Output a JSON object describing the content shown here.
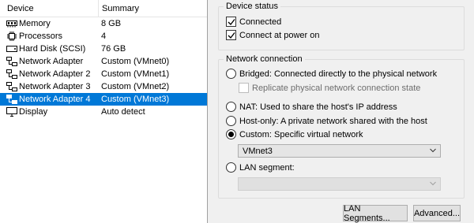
{
  "device_list": {
    "headers": {
      "device": "Device",
      "summary": "Summary"
    },
    "rows": [
      {
        "name": "Memory",
        "summary": "8 GB",
        "icon": "memory-icon",
        "selected": false
      },
      {
        "name": "Processors",
        "summary": "4",
        "icon": "processor-icon",
        "selected": false
      },
      {
        "name": "Hard Disk (SCSI)",
        "summary": "76 GB",
        "icon": "hard-disk-icon",
        "selected": false
      },
      {
        "name": "Network Adapter",
        "summary": "Custom (VMnet0)",
        "icon": "network-adapter-icon",
        "selected": false
      },
      {
        "name": "Network Adapter 2",
        "summary": "Custom (VMnet1)",
        "icon": "network-adapter-icon",
        "selected": false
      },
      {
        "name": "Network Adapter 3",
        "summary": "Custom (VMnet2)",
        "icon": "network-adapter-icon",
        "selected": false
      },
      {
        "name": "Network Adapter 4",
        "summary": "Custom (VMnet3)",
        "icon": "network-adapter-icon",
        "selected": true
      },
      {
        "name": "Display",
        "summary": "Auto detect",
        "icon": "display-icon",
        "selected": false
      }
    ]
  },
  "device_status": {
    "legend": "Device status",
    "connected": {
      "label": "Connected",
      "checked": true
    },
    "connect_at_power_on": {
      "label": "Connect at power on",
      "checked": true
    }
  },
  "network_connection": {
    "legend": "Network connection",
    "bridged": {
      "label": "Bridged: Connected directly to the physical network",
      "selected": false
    },
    "replicate": {
      "label": "Replicate physical network connection state",
      "checked": false,
      "enabled": false
    },
    "nat": {
      "label": "NAT: Used to share the host's IP address",
      "selected": false
    },
    "host_only": {
      "label": "Host-only: A private network shared with the host",
      "selected": false
    },
    "custom": {
      "label": "Custom: Specific virtual network",
      "selected": true
    },
    "custom_select": {
      "value": "VMnet3"
    },
    "lan_segment": {
      "label": "LAN segment:",
      "selected": false
    },
    "lan_select": {
      "value": ""
    }
  },
  "buttons": {
    "lan_segments": "LAN Segments...",
    "advanced": "Advanced..."
  },
  "colors": {
    "selection": "#0078d7",
    "background": "#f0f0f0"
  }
}
